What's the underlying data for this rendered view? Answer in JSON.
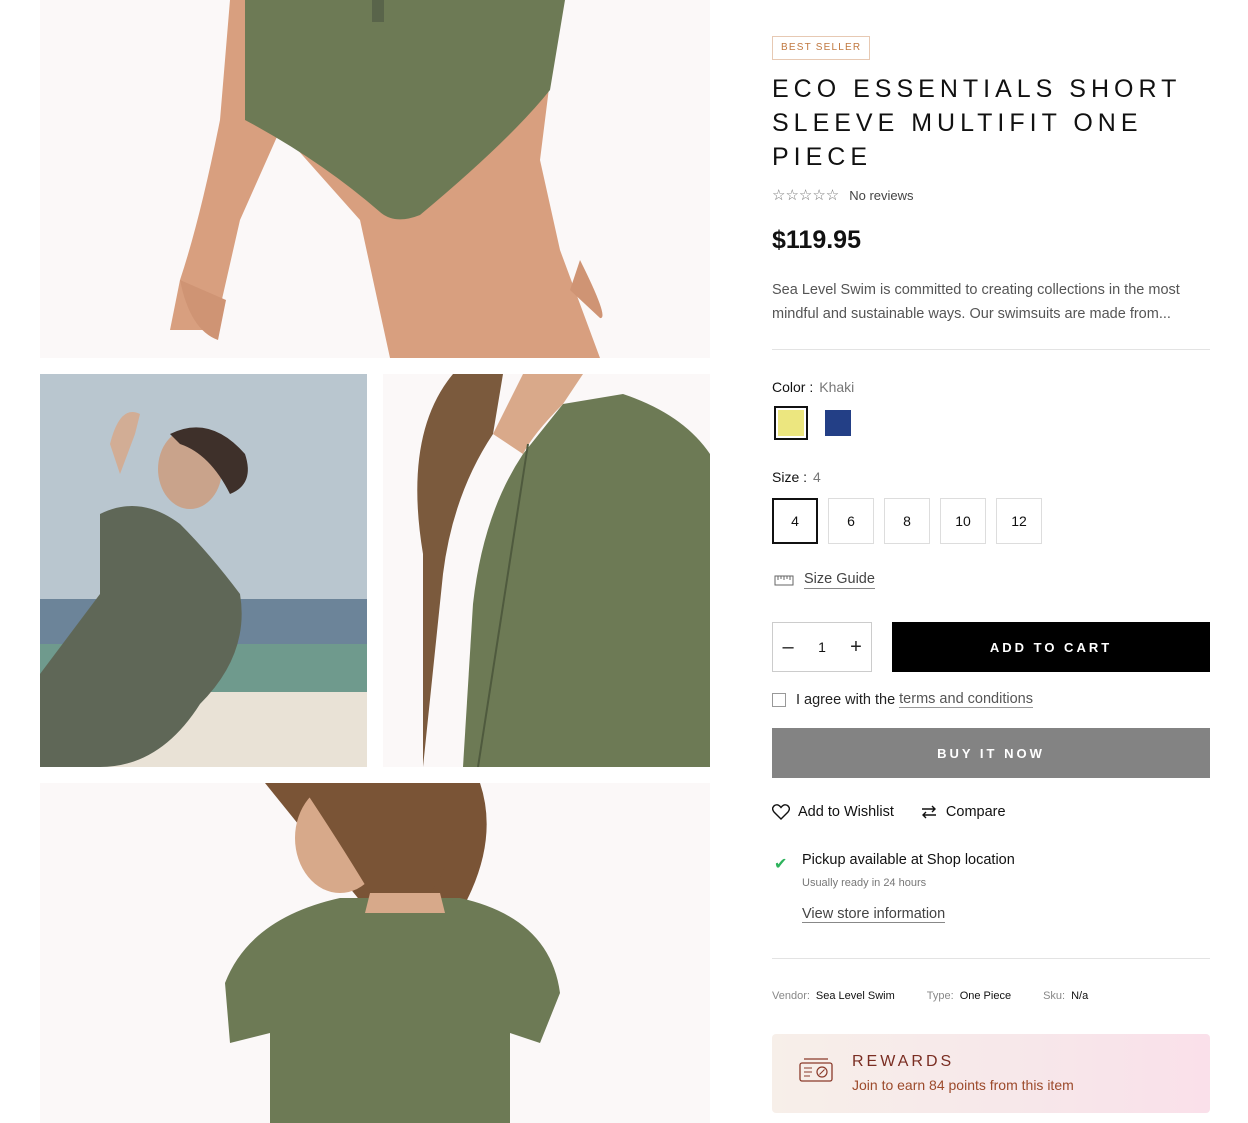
{
  "product": {
    "badge": "BEST SELLER",
    "title": "ECO ESSENTIALS SHORT SLEEVE MULTIFIT ONE PIECE",
    "rating_stars": "☆☆☆☆☆",
    "rating": 0,
    "reviews_text": "No reviews",
    "price": "$119.95",
    "description": "Sea Level Swim is committed to creating collections in the most mindful and sustainable ways. Our swimsuits are made from..."
  },
  "color": {
    "label": "Color :",
    "selected": "Khaki",
    "swatches": [
      {
        "name": "Khaki",
        "hex": "#ece67f",
        "selected": true
      },
      {
        "name": "Navy",
        "hex": "#233f86",
        "selected": false
      }
    ]
  },
  "size": {
    "label": "Size :",
    "selected": "4",
    "options": [
      "4",
      "6",
      "8",
      "10",
      "12"
    ]
  },
  "size_guide": {
    "label": "Size Guide",
    "icon": "ruler-icon"
  },
  "quantity": {
    "value": "1",
    "minus": "–",
    "plus": "+"
  },
  "buttons": {
    "add_to_cart": "ADD TO CART",
    "buy_now": "BUY IT NOW"
  },
  "agree": {
    "text": "I agree with the",
    "link": "terms and conditions",
    "checked": false
  },
  "actions": {
    "wishlist": "Add to Wishlist",
    "compare": "Compare"
  },
  "pickup": {
    "check": "✔",
    "title": "Pickup available at Shop location",
    "ready": "Usually ready in 24 hours",
    "link": "View store information"
  },
  "meta": {
    "vendor_label": "Vendor:",
    "vendor": "Sea Level Swim",
    "type_label": "Type:",
    "type": "One Piece",
    "sku_label": "Sku:",
    "sku": "N/a"
  },
  "rewards": {
    "title": "REWARDS",
    "text": "Join to earn 84 points from this item"
  },
  "colors": {
    "accent_dark": "#000000",
    "buy_now": "#838383",
    "success": "#2db35c",
    "rewards_text": "#7a2d22",
    "badge": "#c0773f"
  }
}
